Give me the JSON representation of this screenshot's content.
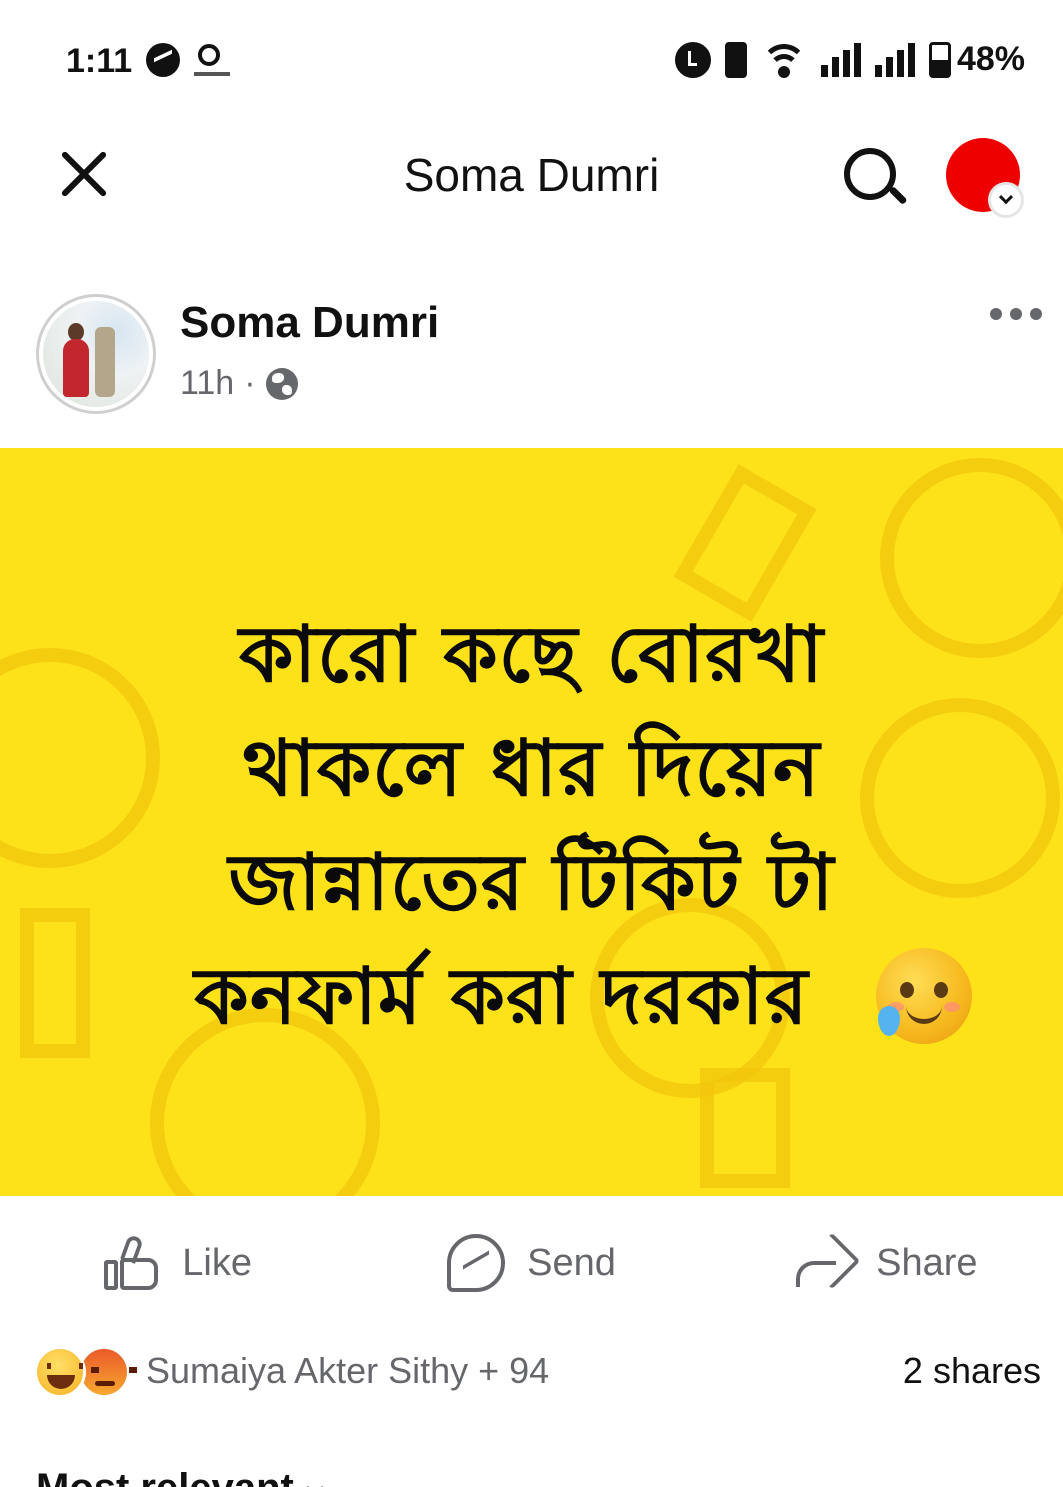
{
  "status_bar": {
    "time": "1:11",
    "icons": [
      "messenger-icon",
      "news-icon",
      "alarm-icon",
      "vibrate-icon",
      "wifi-icon",
      "signal-icon",
      "signal-icon",
      "battery-icon"
    ],
    "battery_percent": "48%",
    "battery_level": 0.48
  },
  "header": {
    "title": "Soma Dumri",
    "profile_color": "#ee0000"
  },
  "post": {
    "author": "Soma Dumri",
    "time": "11h",
    "separator": "·",
    "audience_icon": "globe-icon",
    "image": {
      "background_color": "#fde21a",
      "text_lines": [
        "কারো কছে বোরখা",
        "থাকলে ধার দিয়েন",
        "জান্নাতের টিকিট টা",
        "কনফার্ম করা দরকার"
      ],
      "emoji": "smiling-face-with-tear"
    },
    "actions": {
      "like": "Like",
      "send": "Send",
      "share": "Share"
    },
    "reactions": {
      "icons": [
        "haha-icon",
        "angry-icon"
      ],
      "text": "Sumaiya Akter Sithy + 94"
    },
    "shares": "2 shares"
  },
  "comments": {
    "sort_label": "Most relevant"
  }
}
